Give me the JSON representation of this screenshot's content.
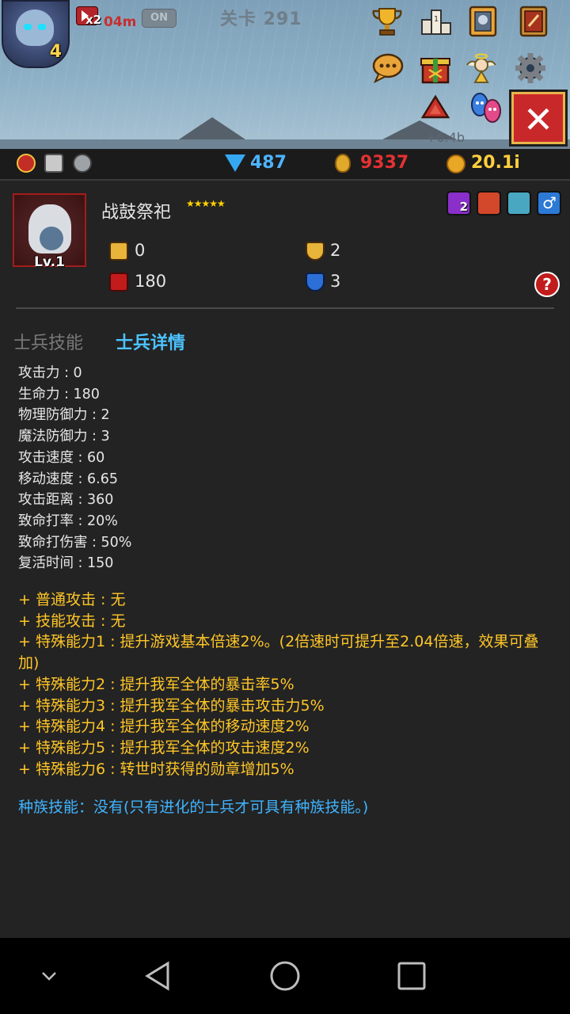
{
  "hud": {
    "hero_level": "4",
    "speed_multiplier": "x2",
    "speed_timer": "04m",
    "auto_toggle": "ON",
    "stage_title": "关卡 291",
    "offline_income": "+6.4b"
  },
  "resources": {
    "gems": "487",
    "medals": "9337",
    "gold": "20.1i"
  },
  "unit": {
    "name": "战鼓祭祀",
    "stars": "★★★★★",
    "level": "Lv.1",
    "attack": "0",
    "hp": "180",
    "armor": "2",
    "magic_resist": "3",
    "upgrade_badge": "2",
    "help": "?"
  },
  "tabs": {
    "skills": "士兵技能",
    "details": "士兵详情"
  },
  "stats": [
    "攻击力 : 0",
    "生命力 : 180",
    "物理防御力 : 2",
    "魔法防御力 : 3",
    "攻击速度 : 60",
    "移动速度 : 6.65",
    "攻击距离 : 360",
    "致命打率 : 20%",
    "致命打伤害 : 50%",
    "复活时间 : 150"
  ],
  "abilities": [
    "+ 普通攻击 : 无",
    "+ 技能攻击 : 无",
    "+ 特殊能力1 : 提升游戏基本倍速2%。(2倍速时可提升至2.04倍速，效果可叠加)",
    "+ 特殊能力2 : 提升我军全体的暴击率5%",
    "+ 特殊能力3 : 提升我军全体的暴击攻击力5%",
    "+ 特殊能力4 : 提升我军全体的移动速度2%",
    "+ 特殊能力5 : 提升我军全体的攻击速度2%",
    "+ 特殊能力6 : 转世时获得的勋章增加5%"
  ],
  "race_skill": "种族技能：没有(只有进化的士兵才可具有种族技能。)",
  "colors": {
    "accent_blue": "#4cc3ff",
    "ability_yellow": "#ffc627",
    "medal_red": "#e53131",
    "gold_yellow": "#ffcf3e",
    "close_red": "#c9282b"
  },
  "icons": {
    "menu": [
      "trophy-icon",
      "leaderboard-icon",
      "quest-book-icon",
      "spellbook-icon",
      "chat-icon",
      "gift-box-icon",
      "angel-icon",
      "settings-gear-icon",
      "upgrade-arrow-icon",
      "allies-icon"
    ],
    "unit_tags": [
      "skill-level-icon",
      "fire-element-icon",
      "robot-type-icon",
      "male-gender-icon"
    ]
  }
}
